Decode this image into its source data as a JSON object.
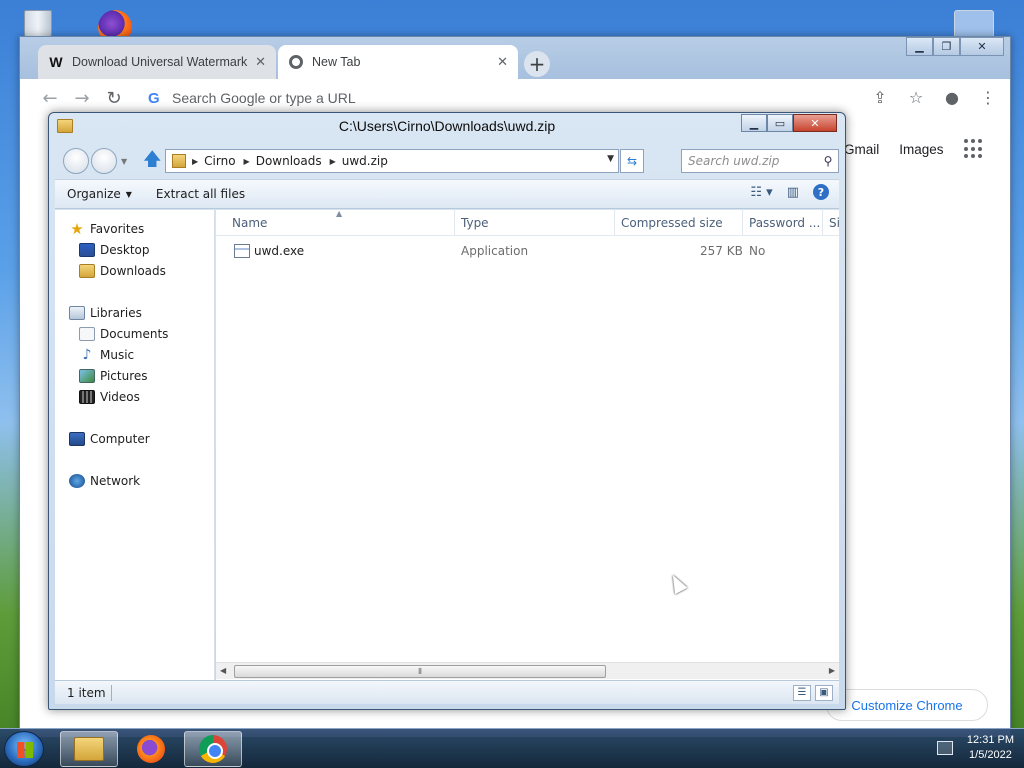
{
  "desktop": {
    "icons": [
      "recycle-bin-icon",
      "firefox-icon"
    ]
  },
  "chrome": {
    "tabs": [
      {
        "label": "Download Universal Watermark D",
        "favicon": "W"
      },
      {
        "label": "New Tab"
      }
    ],
    "omnibox_placeholder": "Search Google or type a URL",
    "ntp_links": {
      "gmail": "Gmail",
      "images": "Images"
    },
    "customize": "Customize Chrome"
  },
  "explorer": {
    "title": "C:\\Users\\Cirno\\Downloads\\uwd.zip",
    "breadcrumbs": [
      "Cirno",
      "Downloads",
      "uwd.zip"
    ],
    "search_placeholder": "Search uwd.zip",
    "commands": {
      "organize": "Organize",
      "extract": "Extract all files"
    },
    "nav": {
      "favorites": "Favorites",
      "desktop": "Desktop",
      "downloads": "Downloads",
      "libraries": "Libraries",
      "documents": "Documents",
      "music": "Music",
      "pictures": "Pictures",
      "videos": "Videos",
      "computer": "Computer",
      "network": "Network"
    },
    "columns": [
      "Name",
      "Type",
      "Compressed size",
      "Password ...",
      "Si"
    ],
    "files": [
      {
        "name": "uwd.exe",
        "type": "Application",
        "compressed_size": "257 KB",
        "password": "No"
      }
    ],
    "status": "1 item"
  },
  "taskbar": {
    "time": "12:31 PM",
    "date": "1/5/2022"
  }
}
